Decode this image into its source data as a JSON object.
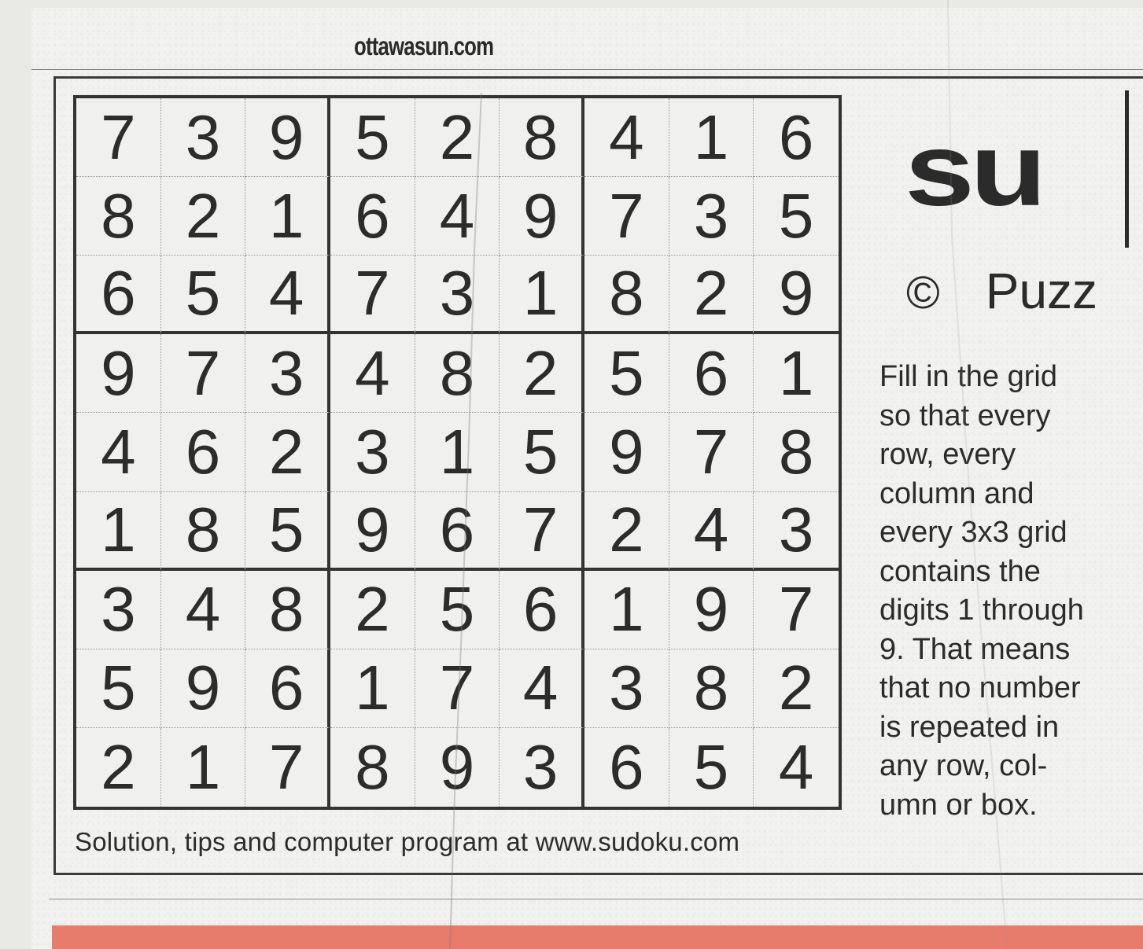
{
  "masthead": "ottawasun.com",
  "puzzle": {
    "grid": [
      [
        "7",
        "3",
        "9",
        "5",
        "2",
        "8",
        "4",
        "1",
        "6"
      ],
      [
        "8",
        "2",
        "1",
        "6",
        "4",
        "9",
        "7",
        "3",
        "5"
      ],
      [
        "6",
        "5",
        "4",
        "7",
        "3",
        "1",
        "8",
        "2",
        "9"
      ],
      [
        "9",
        "7",
        "3",
        "4",
        "8",
        "2",
        "5",
        "6",
        "1"
      ],
      [
        "4",
        "6",
        "2",
        "3",
        "1",
        "5",
        "9",
        "7",
        "8"
      ],
      [
        "1",
        "8",
        "5",
        "9",
        "6",
        "7",
        "2",
        "4",
        "3"
      ],
      [
        "3",
        "4",
        "8",
        "2",
        "5",
        "6",
        "1",
        "9",
        "7"
      ],
      [
        "5",
        "9",
        "6",
        "1",
        "7",
        "4",
        "3",
        "8",
        "2"
      ],
      [
        "2",
        "1",
        "7",
        "8",
        "9",
        "3",
        "6",
        "5",
        "4"
      ]
    ],
    "footer": "Solution, tips and computer program at www.sudoku.com"
  },
  "sidebar": {
    "logo": "su",
    "copyright_symbol": "©",
    "copyright_text": "Puzz",
    "instructions": [
      "Fill in the grid",
      "so that every",
      "row, every",
      "column and",
      "every 3x3 grid",
      "contains the",
      "digits 1 through",
      "9. That means",
      "that no number",
      "is repeated in",
      "any row, col-",
      "umn or box."
    ]
  },
  "colors": {
    "ink": "#2b2b2b",
    "paper": "#f1f1ef",
    "band": "#e77c6c"
  }
}
